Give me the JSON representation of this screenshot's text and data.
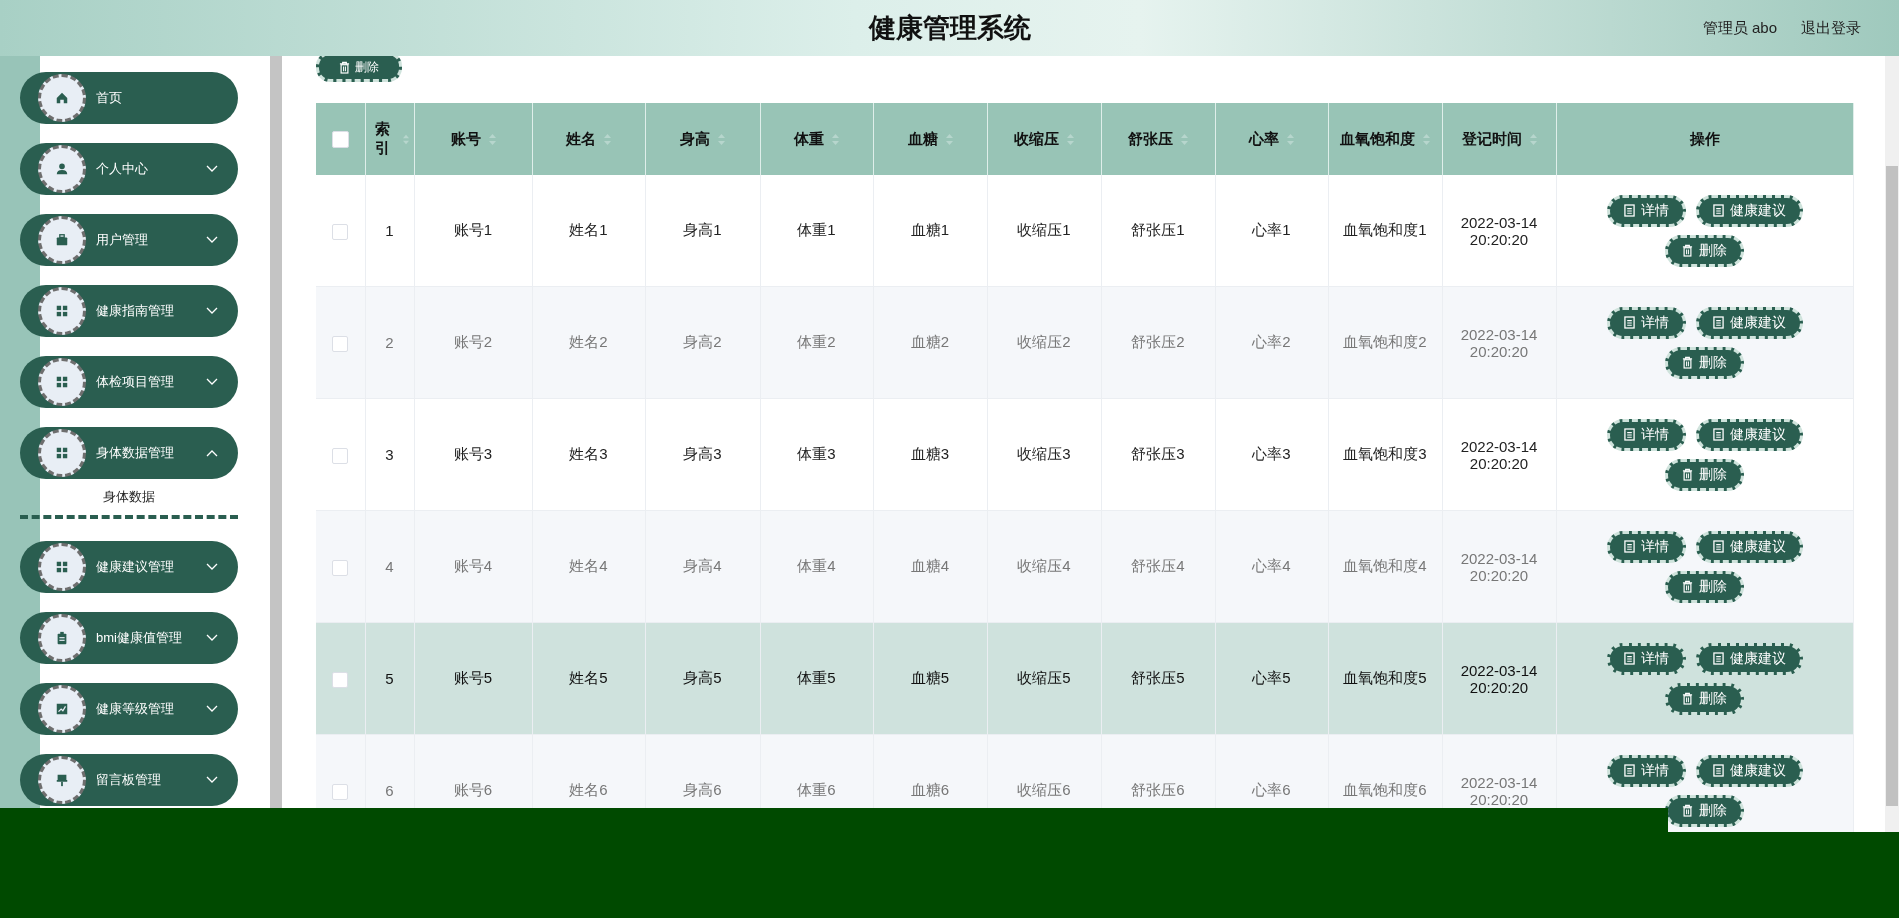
{
  "header": {
    "title": "健康管理系统",
    "user": "管理员 abo",
    "logout": "退出登录"
  },
  "sidebar": {
    "items": [
      {
        "label": "首页",
        "kind": "link"
      },
      {
        "label": "个人中心",
        "kind": "submenu",
        "expanded": false
      },
      {
        "label": "用户管理",
        "kind": "submenu",
        "expanded": false
      },
      {
        "label": "健康指南管理",
        "kind": "submenu",
        "expanded": false
      },
      {
        "label": "体检项目管理",
        "kind": "submenu",
        "expanded": false
      },
      {
        "label": "身体数据管理",
        "kind": "submenu",
        "expanded": true,
        "children": [
          {
            "label": "身体数据",
            "selected": true
          }
        ]
      },
      {
        "label": "健康建议管理",
        "kind": "submenu",
        "expanded": false
      },
      {
        "label": "bmi健康值管理",
        "kind": "submenu",
        "expanded": false
      },
      {
        "label": "健康等级管理",
        "kind": "submenu",
        "expanded": false
      },
      {
        "label": "留言板管理",
        "kind": "submenu",
        "expanded": false
      }
    ]
  },
  "toolbar": {
    "delete_button": "删除"
  },
  "table": {
    "all_checked": false,
    "columns": [
      {
        "label": "索引",
        "sortable": true
      },
      {
        "label": "账号",
        "sortable": true
      },
      {
        "label": "姓名",
        "sortable": true
      },
      {
        "label": "身高",
        "sortable": true
      },
      {
        "label": "体重",
        "sortable": true
      },
      {
        "label": "血糖",
        "sortable": true
      },
      {
        "label": "收缩压",
        "sortable": true
      },
      {
        "label": "舒张压",
        "sortable": true
      },
      {
        "label": "心率",
        "sortable": true
      },
      {
        "label": "血氧饱和度",
        "sortable": true
      },
      {
        "label": "登记时间",
        "sortable": true
      },
      {
        "label": "操作",
        "sortable": false
      }
    ],
    "rows": [
      {
        "checked": false,
        "hovered": false,
        "cells": [
          "1",
          "账号1",
          "姓名1",
          "身高1",
          "体重1",
          "血糖1",
          "收缩压1",
          "舒张压1",
          "心率1",
          "血氧饱和度1",
          "2022-03-14 20:20:20"
        ],
        "actions": [
          "详情",
          "健康建议",
          "删除"
        ]
      },
      {
        "checked": false,
        "hovered": false,
        "cells": [
          "2",
          "账号2",
          "姓名2",
          "身高2",
          "体重2",
          "血糖2",
          "收缩压2",
          "舒张压2",
          "心率2",
          "血氧饱和度2",
          "2022-03-14 20:20:20"
        ],
        "actions": [
          "详情",
          "健康建议",
          "删除"
        ]
      },
      {
        "checked": false,
        "hovered": false,
        "cells": [
          "3",
          "账号3",
          "姓名3",
          "身高3",
          "体重3",
          "血糖3",
          "收缩压3",
          "舒张压3",
          "心率3",
          "血氧饱和度3",
          "2022-03-14 20:20:20"
        ],
        "actions": [
          "详情",
          "健康建议",
          "删除"
        ]
      },
      {
        "checked": false,
        "hovered": false,
        "cells": [
          "4",
          "账号4",
          "姓名4",
          "身高4",
          "体重4",
          "血糖4",
          "收缩压4",
          "舒张压4",
          "心率4",
          "血氧饱和度4",
          "2022-03-14 20:20:20"
        ],
        "actions": [
          "详情",
          "健康建议",
          "删除"
        ]
      },
      {
        "checked": false,
        "hovered": true,
        "cells": [
          "5",
          "账号5",
          "姓名5",
          "身高5",
          "体重5",
          "血糖5",
          "收缩压5",
          "舒张压5",
          "心率5",
          "血氧饱和度5",
          "2022-03-14 20:20:20"
        ],
        "actions": [
          "详情",
          "健康建议",
          "删除"
        ]
      },
      {
        "checked": false,
        "hovered": false,
        "cells": [
          "6",
          "账号6",
          "姓名6",
          "身高6",
          "体重6",
          "血糖6",
          "收缩压6",
          "舒张压6",
          "心率6",
          "血氧饱和度6",
          "2022-03-14 20:20:20"
        ],
        "actions": [
          "详情",
          "健康建议",
          "删除"
        ]
      }
    ]
  }
}
